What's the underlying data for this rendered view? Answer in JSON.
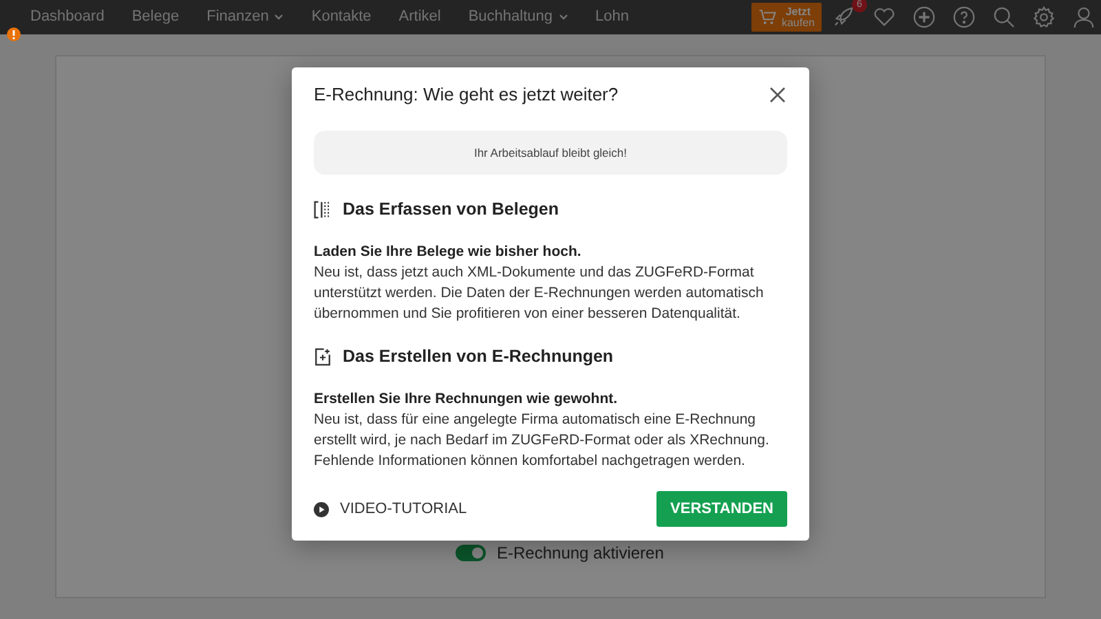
{
  "navbar": {
    "items": [
      {
        "label": "Dashboard",
        "dropdown": false
      },
      {
        "label": "Belege",
        "dropdown": false
      },
      {
        "label": "Finanzen",
        "dropdown": true
      },
      {
        "label": "Kontakte",
        "dropdown": false
      },
      {
        "label": "Artikel",
        "dropdown": false
      },
      {
        "label": "Buchhaltung",
        "dropdown": true
      },
      {
        "label": "Lohn",
        "dropdown": false
      }
    ],
    "buy_button": {
      "line1": "Jetzt",
      "line2": "kaufen"
    },
    "notification_count": "6"
  },
  "background": {
    "toggle": {
      "label": "E-Rechnung aktivieren",
      "on": true
    }
  },
  "modal": {
    "title": "E-Rechnung: Wie geht es jetzt weiter?",
    "info": "Ihr Arbeitsablauf bleibt gleich!",
    "sections": [
      {
        "kind": "capture",
        "heading": "Das Erfassen von Belegen",
        "lead": "Laden Sie Ihre Belege wie bisher hoch.",
        "text": "Neu ist, dass jetzt auch XML-Dokumente und das ZUGFeRD-Format unterstützt werden. Die Daten der E-Rechnungen werden automatisch übernommen und Sie profitieren von einer besseren Datenqualität."
      },
      {
        "kind": "create",
        "heading": "Das Erstellen von E-Rechnungen",
        "lead": "Erstellen Sie Ihre Rechnungen wie gewohnt.",
        "text": "Neu ist, dass für eine angelegte Firma automatisch eine E-Rechnung erstellt wird, je nach Bedarf im ZUGFeRD-Format oder als XRechnung. Fehlende Informationen können komfortabel nachgetragen werden."
      }
    ],
    "video_link": "VIDEO-TUTORIAL",
    "confirm_button": "VERSTANDEN"
  }
}
